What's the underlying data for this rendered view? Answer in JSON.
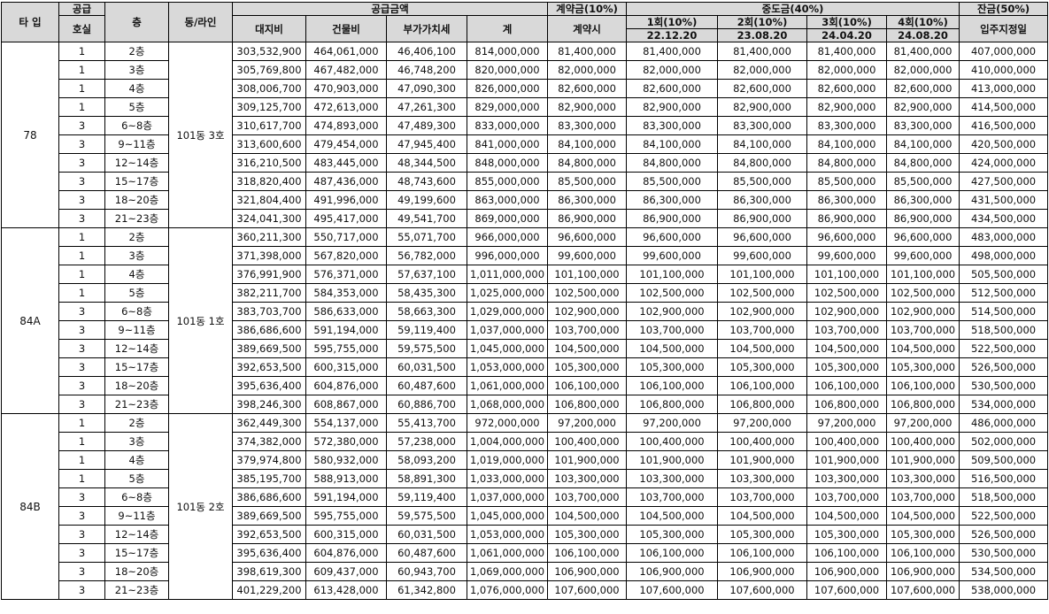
{
  "headers": {
    "type": "타 입",
    "supply_units_top": "공급",
    "supply_units_bottom": "호실",
    "floor": "층",
    "dong_line": "동/라인",
    "supply_amount": "공급금액",
    "contract": "계약금(10%)",
    "middle": "중도금(40%)",
    "balance": "잔금(50%)",
    "land": "대지비",
    "building": "건물비",
    "vat": "부가가치세",
    "total": "계",
    "contract_when": "계약시",
    "m1": "1회(10%)",
    "m2": "2회(10%)",
    "m3": "3회(10%)",
    "m4": "4회(10%)",
    "m1_date": "22.12.20",
    "m2_date": "23.08.20",
    "m3_date": "24.04.20",
    "m4_date": "24.08.20",
    "balance_when": "입주지정일"
  },
  "groups": [
    {
      "type": "78",
      "dong": "101동 3호",
      "rows": [
        [
          "1",
          "2층",
          "303,532,900",
          "464,061,000",
          "46,406,100",
          "814,000,000",
          "81,400,000",
          "81,400,000",
          "81,400,000",
          "81,400,000",
          "81,400,000",
          "407,000,000"
        ],
        [
          "1",
          "3층",
          "305,769,800",
          "467,482,000",
          "46,748,200",
          "820,000,000",
          "82,000,000",
          "82,000,000",
          "82,000,000",
          "82,000,000",
          "82,000,000",
          "410,000,000"
        ],
        [
          "1",
          "4층",
          "308,006,700",
          "470,903,000",
          "47,090,300",
          "826,000,000",
          "82,600,000",
          "82,600,000",
          "82,600,000",
          "82,600,000",
          "82,600,000",
          "413,000,000"
        ],
        [
          "1",
          "5층",
          "309,125,700",
          "472,613,000",
          "47,261,300",
          "829,000,000",
          "82,900,000",
          "82,900,000",
          "82,900,000",
          "82,900,000",
          "82,900,000",
          "414,500,000"
        ],
        [
          "3",
          "6~8층",
          "310,617,700",
          "474,893,000",
          "47,489,300",
          "833,000,000",
          "83,300,000",
          "83,300,000",
          "83,300,000",
          "83,300,000",
          "83,300,000",
          "416,500,000"
        ],
        [
          "3",
          "9~11층",
          "313,600,600",
          "479,454,000",
          "47,945,400",
          "841,000,000",
          "84,100,000",
          "84,100,000",
          "84,100,000",
          "84,100,000",
          "84,100,000",
          "420,500,000"
        ],
        [
          "3",
          "12~14층",
          "316,210,500",
          "483,445,000",
          "48,344,500",
          "848,000,000",
          "84,800,000",
          "84,800,000",
          "84,800,000",
          "84,800,000",
          "84,800,000",
          "424,000,000"
        ],
        [
          "3",
          "15~17층",
          "318,820,400",
          "487,436,000",
          "48,743,600",
          "855,000,000",
          "85,500,000",
          "85,500,000",
          "85,500,000",
          "85,500,000",
          "85,500,000",
          "427,500,000"
        ],
        [
          "3",
          "18~20층",
          "321,804,400",
          "491,996,000",
          "49,199,600",
          "863,000,000",
          "86,300,000",
          "86,300,000",
          "86,300,000",
          "86,300,000",
          "86,300,000",
          "431,500,000"
        ],
        [
          "3",
          "21~23층",
          "324,041,300",
          "495,417,000",
          "49,541,700",
          "869,000,000",
          "86,900,000",
          "86,900,000",
          "86,900,000",
          "86,900,000",
          "86,900,000",
          "434,500,000"
        ]
      ]
    },
    {
      "type": "84A",
      "dong": "101동 1호",
      "rows": [
        [
          "1",
          "2층",
          "360,211,300",
          "550,717,000",
          "55,071,700",
          "966,000,000",
          "96,600,000",
          "96,600,000",
          "96,600,000",
          "96,600,000",
          "96,600,000",
          "483,000,000"
        ],
        [
          "1",
          "3층",
          "371,398,000",
          "567,820,000",
          "56,782,000",
          "996,000,000",
          "99,600,000",
          "99,600,000",
          "99,600,000",
          "99,600,000",
          "99,600,000",
          "498,000,000"
        ],
        [
          "1",
          "4층",
          "376,991,900",
          "576,371,000",
          "57,637,100",
          "1,011,000,000",
          "101,100,000",
          "101,100,000",
          "101,100,000",
          "101,100,000",
          "101,100,000",
          "505,500,000"
        ],
        [
          "1",
          "5층",
          "382,211,700",
          "584,353,000",
          "58,435,300",
          "1,025,000,000",
          "102,500,000",
          "102,500,000",
          "102,500,000",
          "102,500,000",
          "102,500,000",
          "512,500,000"
        ],
        [
          "3",
          "6~8층",
          "383,703,700",
          "586,633,000",
          "58,663,300",
          "1,029,000,000",
          "102,900,000",
          "102,900,000",
          "102,900,000",
          "102,900,000",
          "102,900,000",
          "514,500,000"
        ],
        [
          "3",
          "9~11층",
          "386,686,600",
          "591,194,000",
          "59,119,400",
          "1,037,000,000",
          "103,700,000",
          "103,700,000",
          "103,700,000",
          "103,700,000",
          "103,700,000",
          "518,500,000"
        ],
        [
          "3",
          "12~14층",
          "389,669,500",
          "595,755,000",
          "59,575,500",
          "1,045,000,000",
          "104,500,000",
          "104,500,000",
          "104,500,000",
          "104,500,000",
          "104,500,000",
          "522,500,000"
        ],
        [
          "3",
          "15~17층",
          "392,653,500",
          "600,315,000",
          "60,031,500",
          "1,053,000,000",
          "105,300,000",
          "105,300,000",
          "105,300,000",
          "105,300,000",
          "105,300,000",
          "526,500,000"
        ],
        [
          "3",
          "18~20층",
          "395,636,400",
          "604,876,000",
          "60,487,600",
          "1,061,000,000",
          "106,100,000",
          "106,100,000",
          "106,100,000",
          "106,100,000",
          "106,100,000",
          "530,500,000"
        ],
        [
          "3",
          "21~23층",
          "398,246,300",
          "608,867,000",
          "60,886,700",
          "1,068,000,000",
          "106,800,000",
          "106,800,000",
          "106,800,000",
          "106,800,000",
          "106,800,000",
          "534,000,000"
        ]
      ]
    },
    {
      "type": "84B",
      "dong": "101동 2호",
      "rows": [
        [
          "1",
          "2층",
          "362,449,300",
          "554,137,000",
          "55,413,700",
          "972,000,000",
          "97,200,000",
          "97,200,000",
          "97,200,000",
          "97,200,000",
          "97,200,000",
          "486,000,000"
        ],
        [
          "1",
          "3층",
          "374,382,000",
          "572,380,000",
          "57,238,000",
          "1,004,000,000",
          "100,400,000",
          "100,400,000",
          "100,400,000",
          "100,400,000",
          "100,400,000",
          "502,000,000"
        ],
        [
          "1",
          "4층",
          "379,974,800",
          "580,932,000",
          "58,093,200",
          "1,019,000,000",
          "101,900,000",
          "101,900,000",
          "101,900,000",
          "101,900,000",
          "101,900,000",
          "509,500,000"
        ],
        [
          "1",
          "5층",
          "385,195,700",
          "588,913,000",
          "58,891,300",
          "1,033,000,000",
          "103,300,000",
          "103,300,000",
          "103,300,000",
          "103,300,000",
          "103,300,000",
          "516,500,000"
        ],
        [
          "3",
          "6~8층",
          "386,686,600",
          "591,194,000",
          "59,119,400",
          "1,037,000,000",
          "103,700,000",
          "103,700,000",
          "103,700,000",
          "103,700,000",
          "103,700,000",
          "518,500,000"
        ],
        [
          "3",
          "9~11층",
          "389,669,500",
          "595,755,000",
          "59,575,500",
          "1,045,000,000",
          "104,500,000",
          "104,500,000",
          "104,500,000",
          "104,500,000",
          "104,500,000",
          "522,500,000"
        ],
        [
          "3",
          "12~14층",
          "392,653,500",
          "600,315,000",
          "60,031,500",
          "1,053,000,000",
          "105,300,000",
          "105,300,000",
          "105,300,000",
          "105,300,000",
          "105,300,000",
          "526,500,000"
        ],
        [
          "3",
          "15~17층",
          "395,636,400",
          "604,876,000",
          "60,487,600",
          "1,061,000,000",
          "106,100,000",
          "106,100,000",
          "106,100,000",
          "106,100,000",
          "106,100,000",
          "530,500,000"
        ],
        [
          "3",
          "18~20층",
          "398,619,300",
          "609,437,000",
          "60,943,700",
          "1,069,000,000",
          "106,900,000",
          "106,900,000",
          "106,900,000",
          "106,900,000",
          "106,900,000",
          "534,500,000"
        ],
        [
          "3",
          "21~23층",
          "401,229,200",
          "613,428,000",
          "61,342,800",
          "1,076,000,000",
          "107,600,000",
          "107,600,000",
          "107,600,000",
          "107,600,000",
          "107,600,000",
          "538,000,000"
        ]
      ]
    }
  ]
}
